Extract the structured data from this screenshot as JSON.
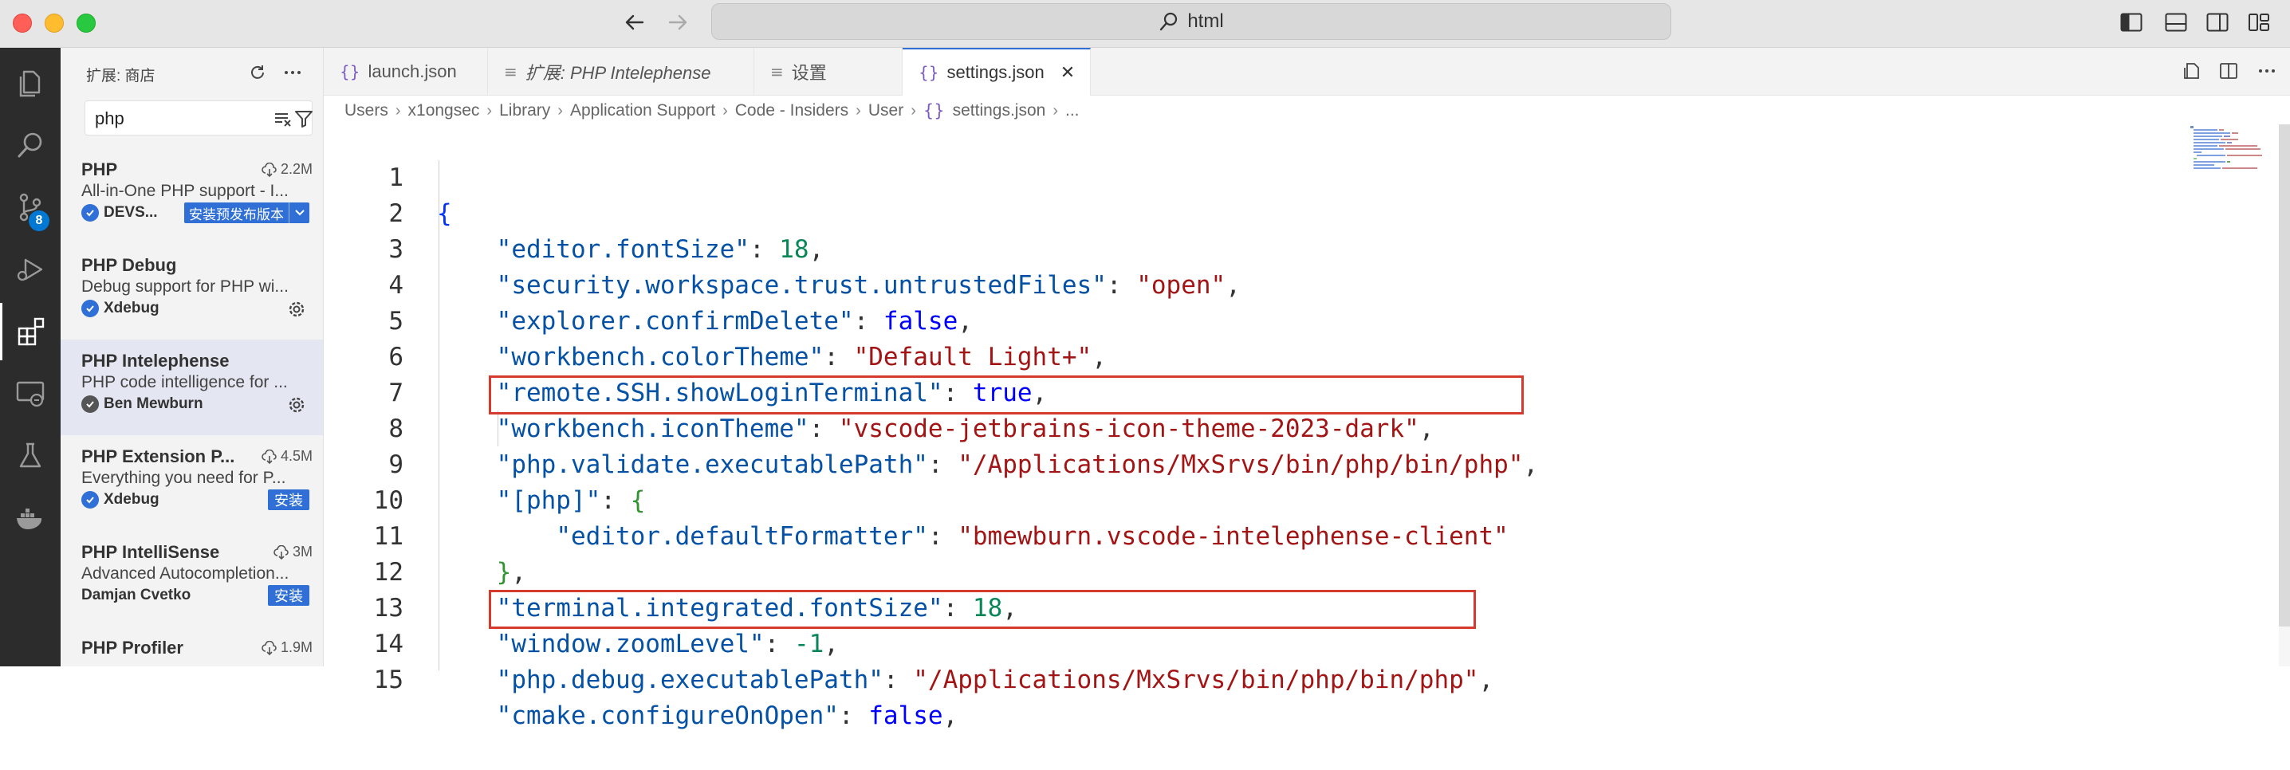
{
  "titlebar": {
    "search_text": "html"
  },
  "activity_bar": {
    "scm_badge": "8"
  },
  "sidebar": {
    "title": "扩展: 商店",
    "search_value": "php",
    "extensions": [
      {
        "name": "PHP",
        "downloads": "2.2M",
        "description": "All-in-One PHP support - I...",
        "publisher": "DEVS...",
        "action": "安装预发布版本",
        "has_dropdown": true
      },
      {
        "name": "PHP Debug",
        "downloads": "",
        "description": "Debug support for PHP wi...",
        "publisher": "Xdebug",
        "action": "",
        "gear": true
      },
      {
        "name": "PHP Intelephense",
        "downloads": "",
        "description": "PHP code intelligence for ...",
        "publisher": "Ben Mewburn",
        "action": "",
        "gear": true,
        "selected": true
      },
      {
        "name": "PHP Extension P...",
        "downloads": "4.5M",
        "description": "Everything you need for P...",
        "publisher": "Xdebug",
        "action": "安装"
      },
      {
        "name": "PHP IntelliSense",
        "downloads": "3M",
        "description": "Advanced Autocompletion...",
        "publisher": "Damjan Cvetko",
        "action": "安装"
      },
      {
        "name": "PHP Profiler",
        "downloads": "1.9M",
        "description": "",
        "publisher": "",
        "action": ""
      }
    ]
  },
  "tabs": [
    {
      "label": "launch.json",
      "icon": "{}"
    },
    {
      "label": "扩展: PHP Intelephense",
      "icon": "≡"
    },
    {
      "label": "设置",
      "icon": "≡"
    },
    {
      "label": "settings.json",
      "icon": "{}",
      "close": "✕"
    }
  ],
  "breadcrumb": [
    "Users",
    "x1ongsec",
    "Library",
    "Application Support",
    "Code - Insiders",
    "User",
    "settings.json",
    "..."
  ],
  "editor": {
    "line_numbers": [
      "1",
      "2",
      "3",
      "4",
      "5",
      "6",
      "7",
      "8",
      "9",
      "10",
      "11",
      "12",
      "13",
      "14",
      "15"
    ],
    "lines": {
      "l1": {
        "open": "{"
      },
      "l2": {
        "key": "\"editor.fontSize\"",
        "val": "18"
      },
      "l3": {
        "key": "\"security.workspace.trust.untrustedFiles\"",
        "val": "\"open\""
      },
      "l4": {
        "key": "\"explorer.confirmDelete\"",
        "val": "false"
      },
      "l5": {
        "key": "\"workbench.colorTheme\"",
        "val": "\"Default Light+\""
      },
      "l6": {
        "key": "\"remote.SSH.showLoginTerminal\"",
        "val": "true"
      },
      "l7": {
        "key": "\"workbench.iconTheme\"",
        "val": "\"vscode-jetbrains-icon-theme-2023-dark\""
      },
      "l8": {
        "key": "\"php.validate.executablePath\"",
        "val": "\"/Applications/MxSrvs/bin/php/bin/php\""
      },
      "l9": {
        "key": "\"[php]\"",
        "open": "{"
      },
      "l10": {
        "key": "\"editor.defaultFormatter\"",
        "val": "\"bmewburn.vscode-intelephense-client\""
      },
      "l11": {
        "close": "}"
      },
      "l12": {
        "key": "\"terminal.integrated.fontSize\"",
        "val": "18"
      },
      "l13": {
        "key": "\"window.zoomLevel\"",
        "val": "-1"
      },
      "l14": {
        "key": "\"php.debug.executablePath\"",
        "val": "\"/Applications/MxSrvs/bin/php/bin/php\""
      },
      "l15": {
        "key": "\"cmake.configureOnOpen\"",
        "val": "false"
      }
    }
  },
  "colors": {
    "accent": "#2f6fd6",
    "highlight_box": "#d63a2d",
    "json_key": "#0451a5",
    "json_string": "#a31515",
    "json_number": "#098658",
    "json_keyword": "#0000ff"
  }
}
